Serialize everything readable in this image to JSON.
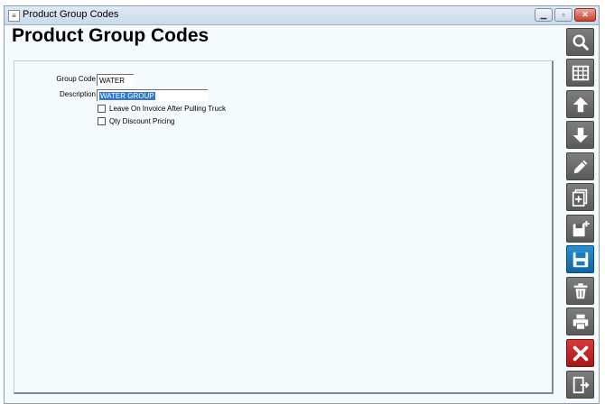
{
  "window": {
    "title": "Product Group Codes",
    "icon": "app-icon"
  },
  "page": {
    "title": "Product Group Codes"
  },
  "form": {
    "group_code": {
      "label": "Group Code",
      "value": "WATER"
    },
    "description": {
      "label": "Description",
      "value": "WATER GROUP"
    },
    "checkboxes": [
      {
        "label": "Leave On Invoice After Pulling Truck",
        "checked": false
      },
      {
        "label": "Qty Discount Pricing",
        "checked": false
      }
    ]
  },
  "toolbar": [
    {
      "name": "search-icon",
      "color": "#5f5f5f"
    },
    {
      "name": "grid-icon",
      "color": "#5f5f5f"
    },
    {
      "name": "arrow-up-icon",
      "color": "#5f5f5f"
    },
    {
      "name": "arrow-down-icon",
      "color": "#5f5f5f"
    },
    {
      "name": "pencil-icon",
      "color": "#5f5f5f"
    },
    {
      "name": "new-document-icon",
      "color": "#5f5f5f"
    },
    {
      "name": "save-new-icon",
      "color": "#5f5f5f"
    },
    {
      "name": "save-icon",
      "color": "#1a7bc0"
    },
    {
      "name": "delete-icon",
      "color": "#5f5f5f"
    },
    {
      "name": "print-icon",
      "color": "#5f5f5f"
    },
    {
      "name": "close-icon",
      "color": "#c62828"
    },
    {
      "name": "exit-icon",
      "color": "#5f5f5f"
    }
  ]
}
